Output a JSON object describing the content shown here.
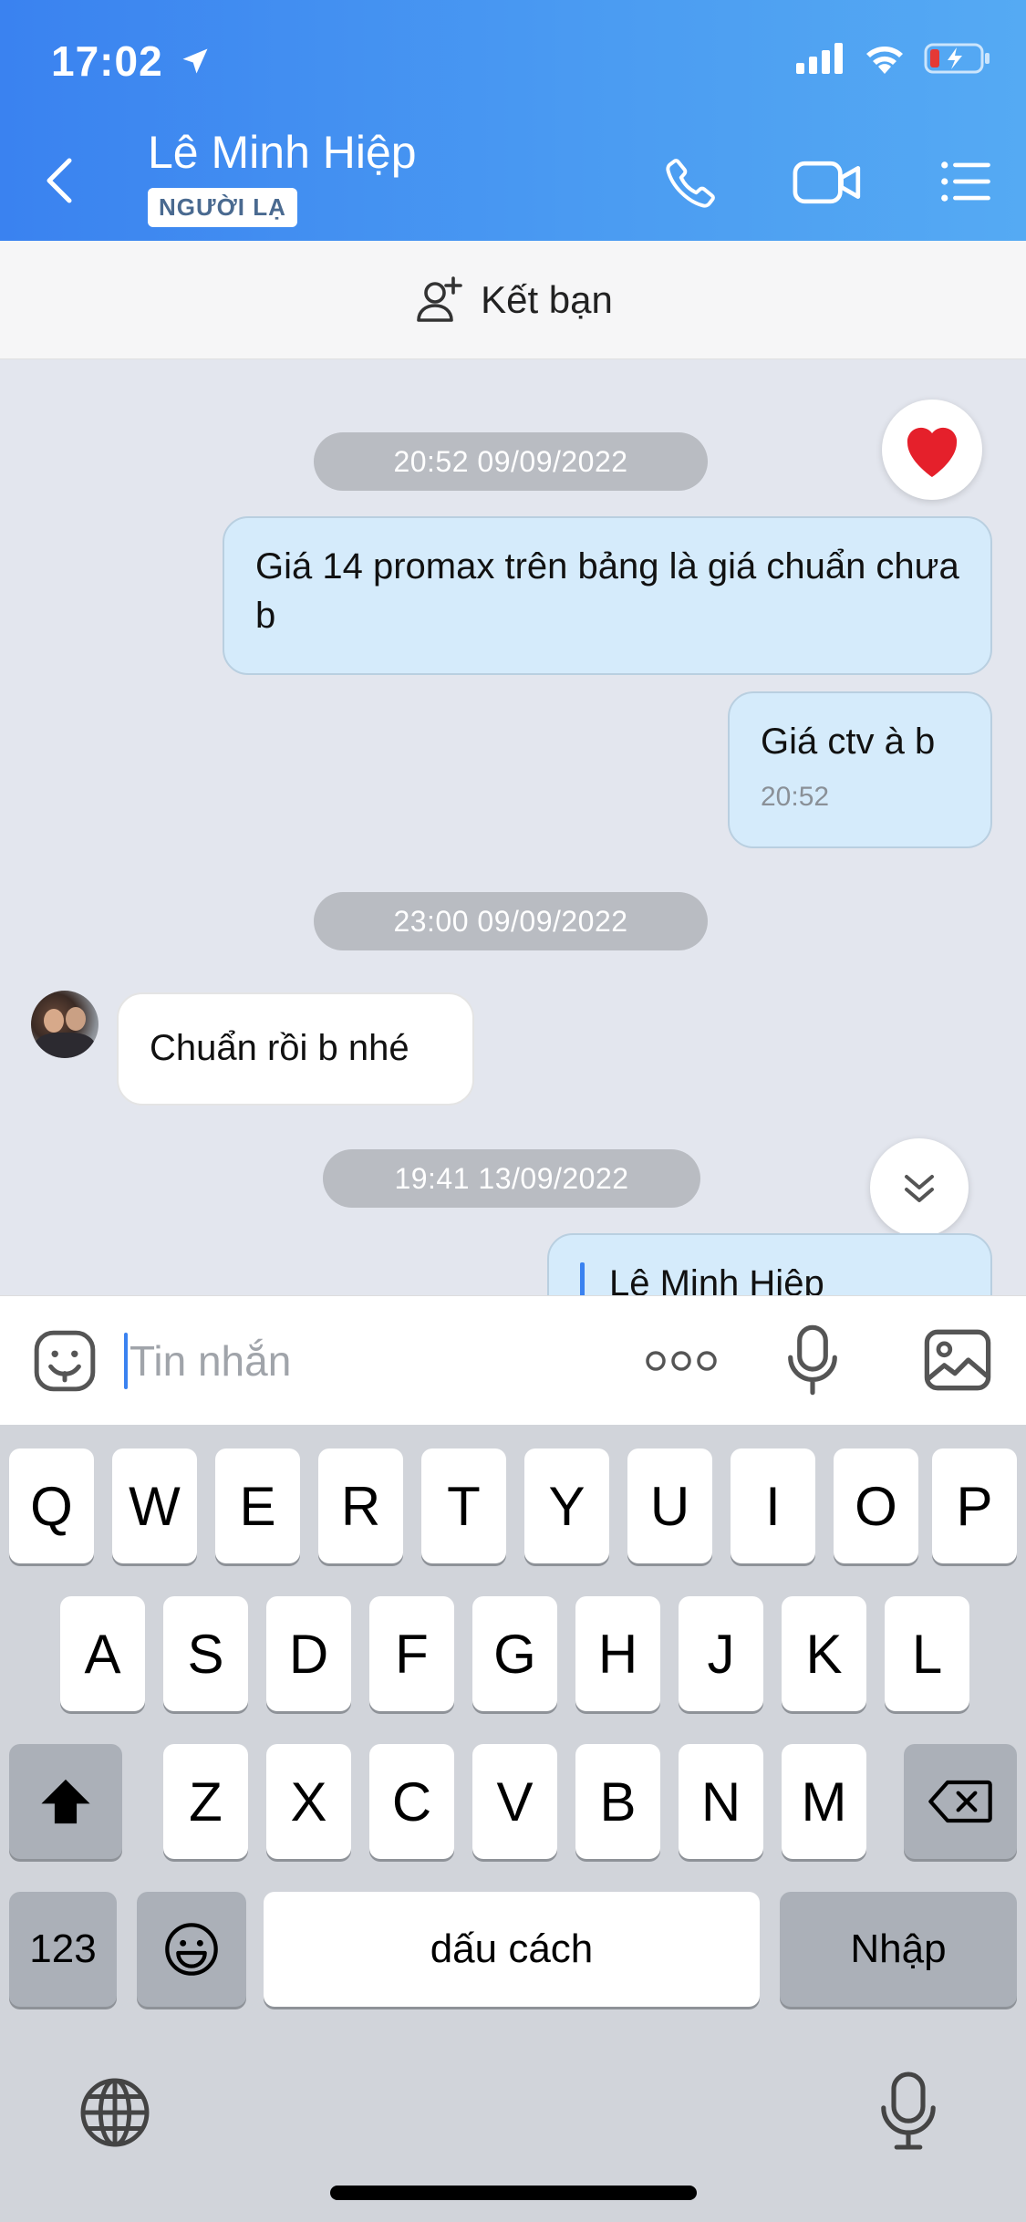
{
  "status": {
    "time": "17:02"
  },
  "header": {
    "contact_name": "Lê Minh Hiệp",
    "badge": "NGƯỜI LẠ",
    "accent": "#3a82f0"
  },
  "add_friend": {
    "label": "Kết bạn"
  },
  "messages": [
    {
      "type": "timestamp",
      "text": "20:52 09/09/2022"
    },
    {
      "type": "outgoing",
      "text": "Giá 14 promax trên bảng là giá chuẩn chưa b"
    },
    {
      "type": "outgoing",
      "text": "Giá ctv à b",
      "time": "20:52"
    },
    {
      "type": "timestamp",
      "text": "23:00 09/09/2022"
    },
    {
      "type": "incoming",
      "text": "Chuẩn rồi b nhé"
    },
    {
      "type": "timestamp",
      "text": "19:41 13/09/2022"
    },
    {
      "type": "outgoing-quote",
      "quoted_name": "Lê Minh Hiệp"
    }
  ],
  "input": {
    "placeholder": "Tin nhắn"
  },
  "keyboard": {
    "row1": [
      "Q",
      "W",
      "E",
      "R",
      "T",
      "Y",
      "U",
      "I",
      "O",
      "P"
    ],
    "row2": [
      "A",
      "S",
      "D",
      "F",
      "G",
      "H",
      "J",
      "K",
      "L"
    ],
    "row3": [
      "Z",
      "X",
      "C",
      "V",
      "B",
      "N",
      "M"
    ],
    "numbers_key": "123",
    "space_key": "dấu cách",
    "return_key": "Nhập"
  },
  "icons": [
    "location-arrow-icon",
    "signal-icon",
    "wifi-icon",
    "battery-icon",
    "back-icon",
    "phone-icon",
    "video-icon",
    "menu-icon",
    "add-friend-icon",
    "heart-icon",
    "chevron-double-down-icon",
    "sticker-icon",
    "more-icon",
    "mic-icon",
    "image-icon",
    "shift-icon",
    "backspace-icon",
    "emoji-icon",
    "globe-icon",
    "dictation-icon"
  ]
}
